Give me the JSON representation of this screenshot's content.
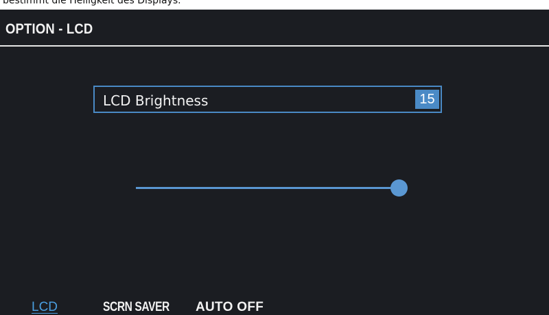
{
  "caption": "bestimmt die Helligkeit des Displays.",
  "header": {
    "title": "OPTION - LCD"
  },
  "parameter": {
    "label": "LCD Brightness",
    "value": "15"
  },
  "slider": {
    "level_fraction": 1.0
  },
  "tabs": [
    {
      "label": "LCD",
      "selected": true
    },
    {
      "label": "SCRN SAVER",
      "selected": false
    },
    {
      "label": "AUTO OFF",
      "selected": false
    }
  ],
  "colors": {
    "background": "#1b1d22",
    "accent": "#4a8ac6",
    "slider": "#5a97d2",
    "selected_tab": "#4a9ee0",
    "text": "#f2f2f2"
  }
}
